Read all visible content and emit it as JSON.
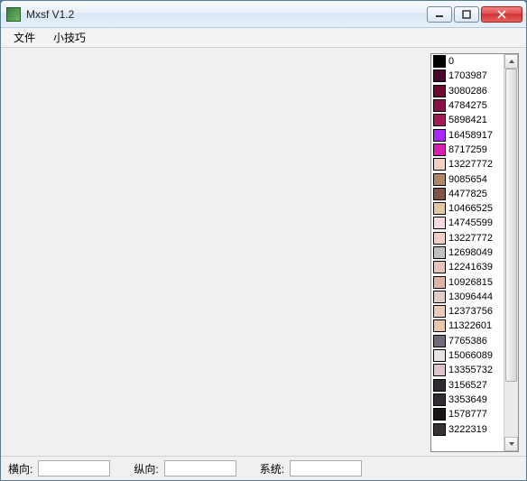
{
  "window": {
    "title": "Mxsf V1.2"
  },
  "menu": {
    "items": [
      "文件",
      "小技巧"
    ]
  },
  "palette": [
    {
      "color": "#000000",
      "value": "0"
    },
    {
      "color": "#4a0a2e",
      "value": "1703987"
    },
    {
      "color": "#6e0a32",
      "value": "3080286"
    },
    {
      "color": "#8a1048",
      "value": "4784275"
    },
    {
      "color": "#a31a54",
      "value": "5898421"
    },
    {
      "color": "#a828fb",
      "value": "16458917"
    },
    {
      "color": "#d81fb0",
      "value": "8717259"
    },
    {
      "color": "#f2d0c2",
      "value": "13227772"
    },
    {
      "color": "#b08666",
      "value": "9085654"
    },
    {
      "color": "#7f5444",
      "value": "4477825"
    },
    {
      "color": "#e2c89f",
      "value": "10466525"
    },
    {
      "color": "#f5dbe0",
      "value": "14745599"
    },
    {
      "color": "#f2d0c2",
      "value": "13227772"
    },
    {
      "color": "#c1c1c1",
      "value": "12698049"
    },
    {
      "color": "#e7c5ba",
      "value": "12241639"
    },
    {
      "color": "#dfb4a6",
      "value": "10926815"
    },
    {
      "color": "#e0cec7",
      "value": "13096444"
    },
    {
      "color": "#ecccbc",
      "value": "12373756"
    },
    {
      "color": "#e9c5ac",
      "value": "11322601"
    },
    {
      "color": "#726a76",
      "value": "7765386"
    },
    {
      "color": "#e9e2e5",
      "value": "15066089"
    },
    {
      "color": "#dcc4cb",
      "value": "13355732"
    },
    {
      "color": "#2f2930",
      "value": "3156527"
    },
    {
      "color": "#312c33",
      "value": "3353649"
    },
    {
      "color": "#181418",
      "value": "1578777"
    },
    {
      "color": "#373131",
      "value": "3222319"
    }
  ],
  "status": {
    "h_label": "横向:",
    "v_label": "纵向:",
    "sys_label": "系统:",
    "h_value": "",
    "v_value": "",
    "sys_value": ""
  }
}
